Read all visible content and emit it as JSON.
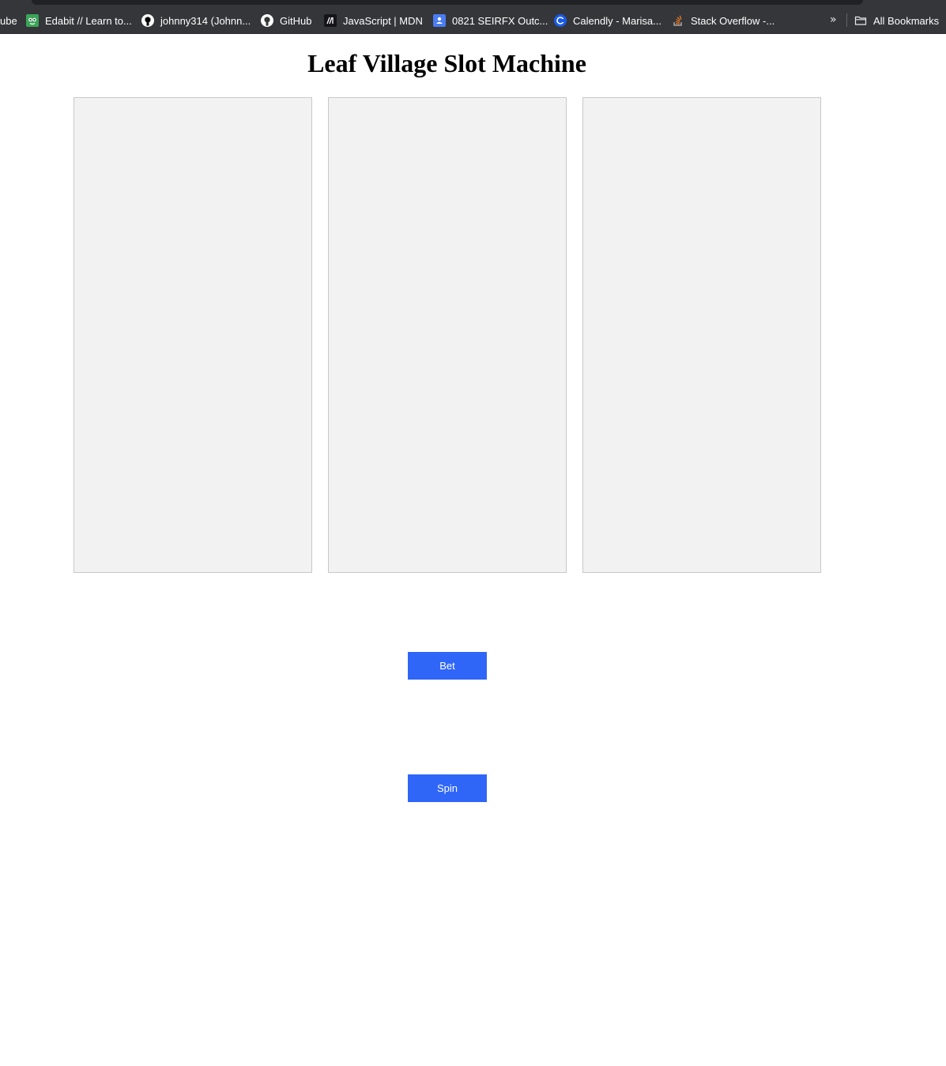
{
  "browser": {
    "bookmarks": [
      {
        "label": "ube",
        "icon": "youtube-icon"
      },
      {
        "label": "Edabit // Learn to...",
        "icon": "edabit-icon"
      },
      {
        "label": "johnny314 (Johnn...",
        "icon": "github-icon"
      },
      {
        "label": "GitHub",
        "icon": "github-icon"
      },
      {
        "label": "JavaScript | MDN",
        "icon": "mdn-icon"
      },
      {
        "label": "0821 SEIRFX Outc...",
        "icon": "contacts-icon"
      },
      {
        "label": "Calendly - Marisa...",
        "icon": "calendly-icon"
      },
      {
        "label": "Stack Overflow -...",
        "icon": "stackoverflow-icon"
      }
    ],
    "overflow_chevron": "»",
    "all_bookmarks_label": "All Bookmarks",
    "all_bookmarks_icon": "folder-icon"
  },
  "page": {
    "title": "Leaf Village Slot Machine",
    "bet_label": "Bet",
    "spin_label": "Spin",
    "reel_count": 3
  },
  "colors": {
    "button_bg": "#2f66f7",
    "reel_bg": "#f2f2f2",
    "reel_border": "#c8c8c8",
    "bookmarks_bar_bg": "#35363a"
  }
}
